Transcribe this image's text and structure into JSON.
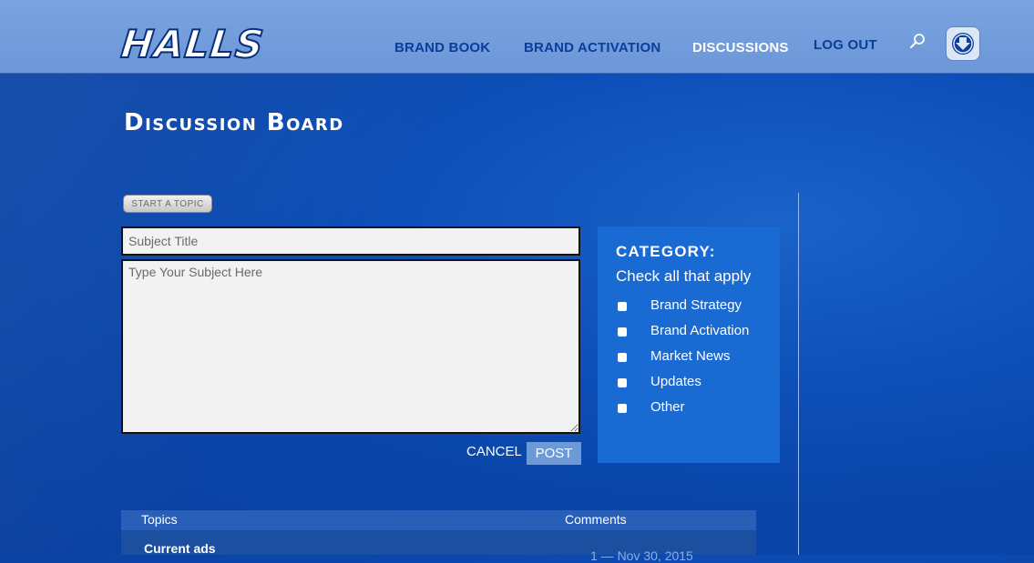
{
  "header": {
    "logo_text": "HALLS",
    "nav": {
      "brand_book": "BRAND BOOK",
      "brand_activation": "BRAND ACTIVATION",
      "discussions": "DISCUSSIONS",
      "log_out": "LOG OUT"
    },
    "icons": {
      "search": "search-icon",
      "download": "download-icon"
    }
  },
  "page": {
    "title": "Discussion Board",
    "start_topic_label": "START A TOPIC"
  },
  "form": {
    "subject_placeholder": "Subject Title",
    "body_placeholder": "Type Your Subject Here",
    "cancel_label": "CANCEL",
    "post_label": "POST"
  },
  "category": {
    "heading": "CATEGORY:",
    "subheading": "Check all that apply",
    "items": [
      {
        "label": "Brand Strategy"
      },
      {
        "label": "Brand Activation"
      },
      {
        "label": "Market News"
      },
      {
        "label": "Updates"
      },
      {
        "label": "Other"
      }
    ]
  },
  "topics_table": {
    "columns": [
      "Topics",
      "Comments"
    ],
    "rows": [
      {
        "topic": "Current ads",
        "meta": "1 — Nov 30, 2015"
      }
    ]
  },
  "colors": {
    "background": "#0d4fb8",
    "header": "#7aa3e0",
    "nav_link": "#0b3d9a",
    "nav_active": "#ffffff",
    "category_panel": "#1a6ad4",
    "post_button": "#6d9ad6"
  }
}
